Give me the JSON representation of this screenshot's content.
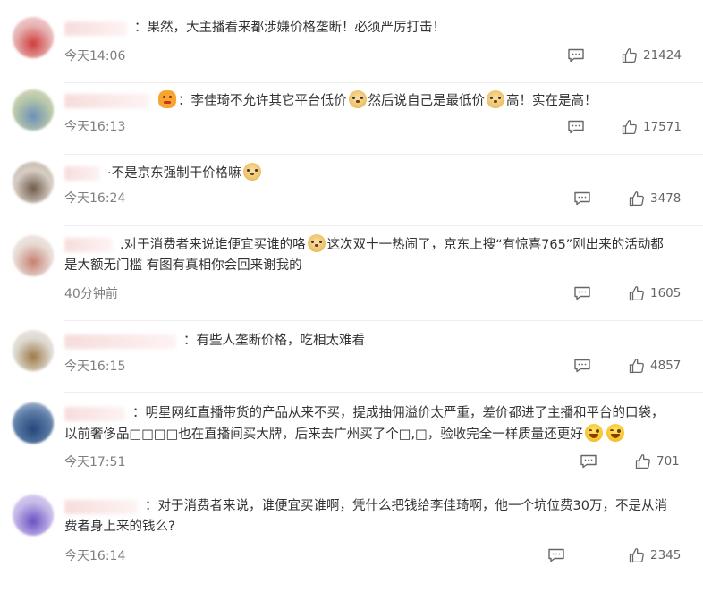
{
  "comments": [
    {
      "avatar_colors": [
        "#e7b3b3",
        "#cf3b3b",
        "#f3dede"
      ],
      "segments": [
        {
          "t": "text",
          "v": "："
        },
        {
          "t": "text",
          "v": "果然，大主播看来都涉嫌价格垄断！必须严厉打击！"
        }
      ],
      "time": "今天14:06",
      "likes": "21424"
    },
    {
      "avatar_colors": [
        "#b8c9a8",
        "#6d8fb9",
        "#e2ddc0"
      ],
      "segments": [
        {
          "t": "emo",
          "v": "face"
        },
        {
          "t": "text",
          "v": "："
        },
        {
          "t": "text",
          "v": "李佳琦不允许其它平台低价"
        },
        {
          "t": "emo",
          "v": "doge"
        },
        {
          "t": "text",
          "v": "然后说自己是最低价"
        },
        {
          "t": "emo",
          "v": "doge"
        },
        {
          "t": "text",
          "v": "高！实在是高！"
        }
      ],
      "time": "今天16:13",
      "likes": "17571"
    },
    {
      "avatar_colors": [
        "#d8cfc6",
        "#6e5a49",
        "#b7a99a"
      ],
      "segments": [
        {
          "t": "text",
          "v": "·"
        },
        {
          "t": "text",
          "v": "不是京东强制干价格嘛"
        },
        {
          "t": "emo",
          "v": "doge"
        }
      ],
      "time": "今天16:24",
      "likes": "3478"
    },
    {
      "avatar_colors": [
        "#e8dcd6",
        "#c77f70",
        "#f2eae7"
      ],
      "segments": [
        {
          "t": "text",
          "v": "."
        },
        {
          "t": "text",
          "v": "对于消费者来说谁便宜买谁的咯"
        },
        {
          "t": "emo",
          "v": "doge"
        },
        {
          "t": "text",
          "v": "这次双十一热闹了，京东上搜“有惊喜765”刚出来的活动都是大额无门槛 有图有真相你会回来谢我的"
        }
      ],
      "time": "40分钟前",
      "likes": "1605"
    },
    {
      "avatar_colors": [
        "#dedad3",
        "#9c7a46",
        "#f1ece4"
      ],
      "segments": [
        {
          "t": "text",
          "v": "："
        },
        {
          "t": "text",
          "v": "有些人垄断价格，吃相太难看"
        }
      ],
      "time": "今天16:15",
      "likes": "4857"
    },
    {
      "avatar_colors": [
        "#5f7ea8",
        "#24467a",
        "#c9d4e3"
      ],
      "segments": [
        {
          "t": "text",
          "v": "："
        },
        {
          "t": "text",
          "v": "明星网红直播带货的产品从来不买，提成抽佣溢价太严重，差价都进了主播和平台的口袋，以前奢侈品□□□□也在直播间买大牌，后来去广州买了个□,□，验收完全一样质量还更好"
        },
        {
          "t": "emo",
          "v": "laugh"
        },
        {
          "t": "emo",
          "v": "laugh"
        }
      ],
      "time": "今天17:51",
      "likes": "701"
    },
    {
      "avatar_colors": [
        "#c6b8e8",
        "#6a4fc4",
        "#e4dcf6"
      ],
      "segments": [
        {
          "t": "text",
          "v": "："
        },
        {
          "t": "text",
          "v": "对于消费者来说，谁便宜买谁啊，凭什么把钱给李佳琦啊，他一个坑位费30万，不是从消费者身上来的钱么?"
        }
      ],
      "time": "今天16:14",
      "likes": "2345"
    }
  ]
}
